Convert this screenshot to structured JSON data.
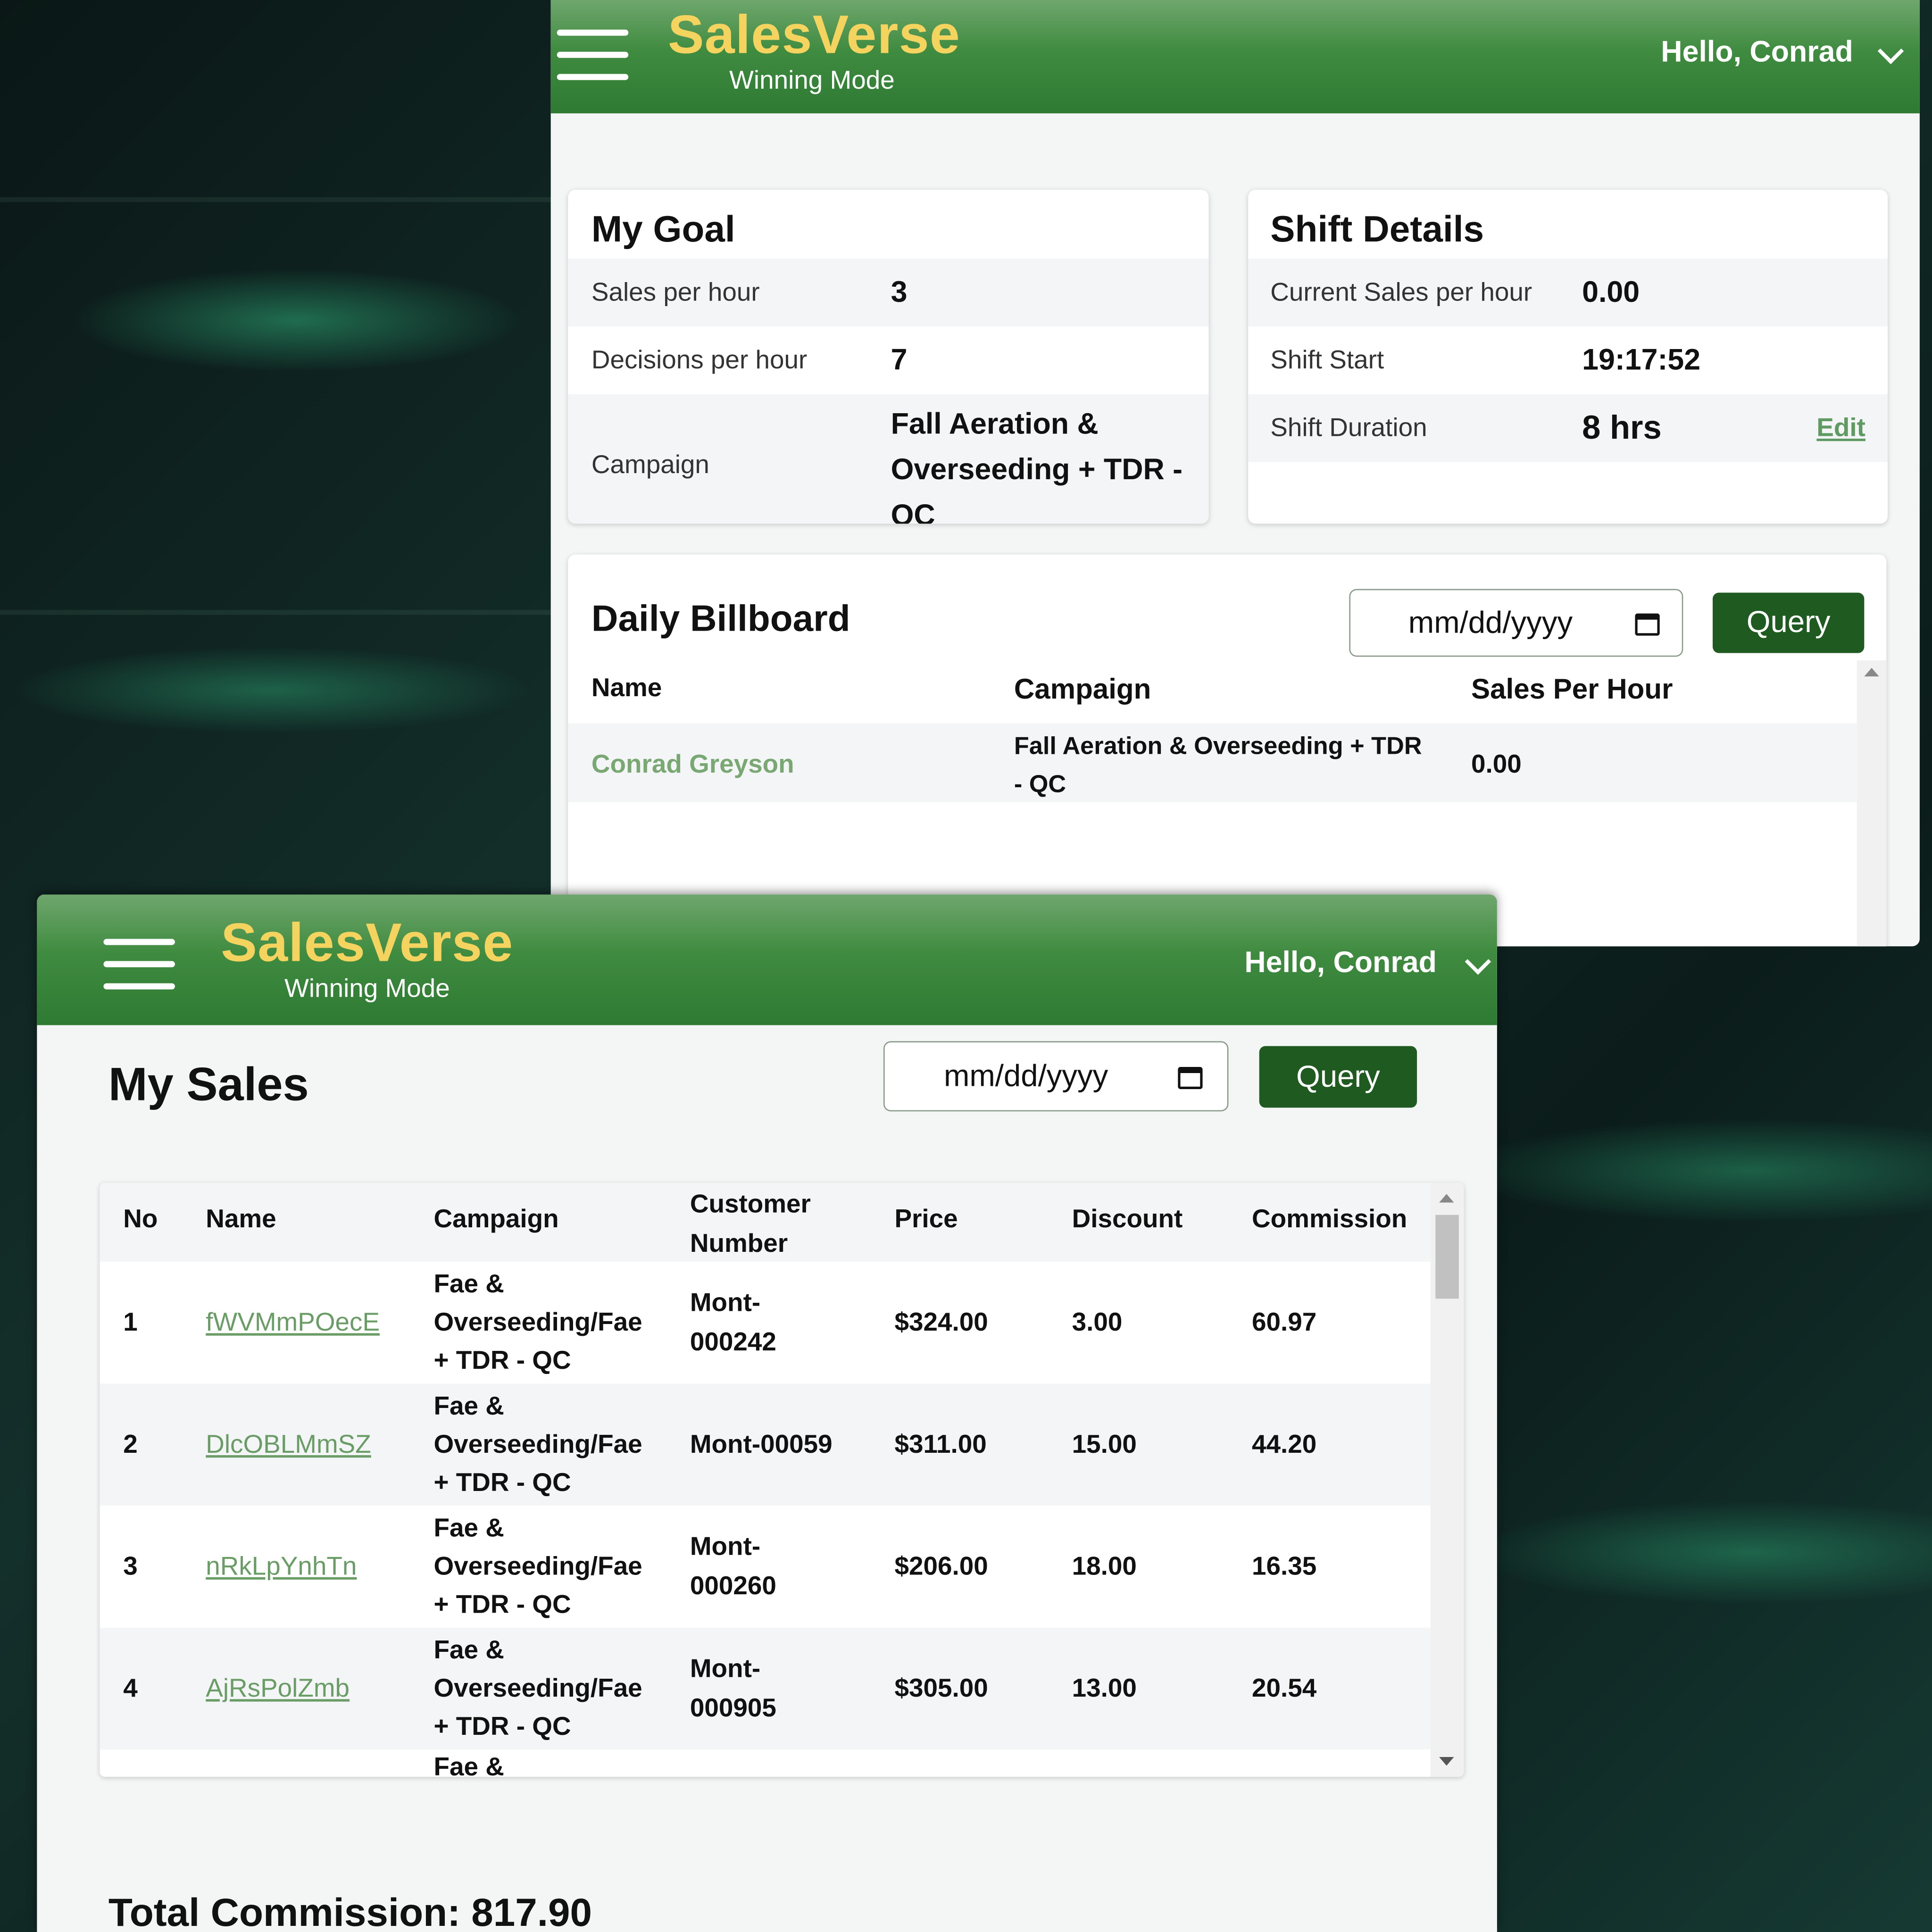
{
  "app": {
    "brand_name": "SalesVerse",
    "brand_subtitle": "Winning Mode",
    "greeting": "Hello, Conrad",
    "colors": {
      "header": "#3f8b40",
      "brand": "#f4d35e",
      "button": "#1f5a21",
      "link": "#7aa873"
    }
  },
  "goal": {
    "title": "My Goal",
    "rows": [
      {
        "label": "Sales per hour",
        "value": "3"
      },
      {
        "label": "Decisions per hour",
        "value": "7"
      },
      {
        "label": "Campaign",
        "value_lines": [
          "Fall Aeration &",
          "Overseeding + TDR -",
          "QC"
        ]
      }
    ]
  },
  "shift": {
    "title": "Shift Details",
    "rows": [
      {
        "label": "Current Sales per hour",
        "value": "0.00"
      },
      {
        "label": "Shift Start",
        "value": "19:17:52"
      },
      {
        "label": "Shift Duration",
        "value": "8 hrs"
      }
    ],
    "edit_label": "Edit"
  },
  "billboard": {
    "title": "Daily Billboard",
    "date_placeholder": "mm/dd/yyyy",
    "query_label": "Query",
    "headers": [
      "Name",
      "Campaign",
      "Sales Per Hour"
    ],
    "rows": [
      {
        "name": "Conrad Greyson",
        "campaign_lines": [
          "Fall Aeration & Overseeding + TDR",
          "- QC"
        ],
        "sales_per_hour": "0.00"
      }
    ]
  },
  "my_sales": {
    "title": "My Sales",
    "date_placeholder": "mm/dd/yyyy",
    "query_label": "Query",
    "headers": [
      "No",
      "Name",
      "Campaign",
      "Customer",
      "Number",
      "Price",
      "Discount",
      "Commission"
    ],
    "campaign_lines": [
      "Fae &",
      "Overseeding/Fae",
      "+ TDR - QC"
    ],
    "rows": [
      {
        "no": "1",
        "name": "fWVMmPOecE",
        "customer_lines": [
          "Mont-",
          "000242"
        ],
        "price": "$324.00",
        "discount": "3.00",
        "commission": "60.97"
      },
      {
        "no": "2",
        "name": "DlcOBLMmSZ",
        "customer_lines": [
          "Mont-00059"
        ],
        "price": "$311.00",
        "discount": "15.00",
        "commission": "44.20"
      },
      {
        "no": "3",
        "name": "nRkLpYnhTn",
        "customer_lines": [
          "Mont-",
          "000260"
        ],
        "price": "$206.00",
        "discount": "18.00",
        "commission": "16.35"
      },
      {
        "no": "4",
        "name": "AjRsPolZmb",
        "customer_lines": [
          "Mont-",
          "000905"
        ],
        "price": "$305.00",
        "discount": "13.00",
        "commission": "20.54"
      }
    ],
    "partial_row_text": "Fae &",
    "total_commission": "Total Commission: 817.90"
  }
}
